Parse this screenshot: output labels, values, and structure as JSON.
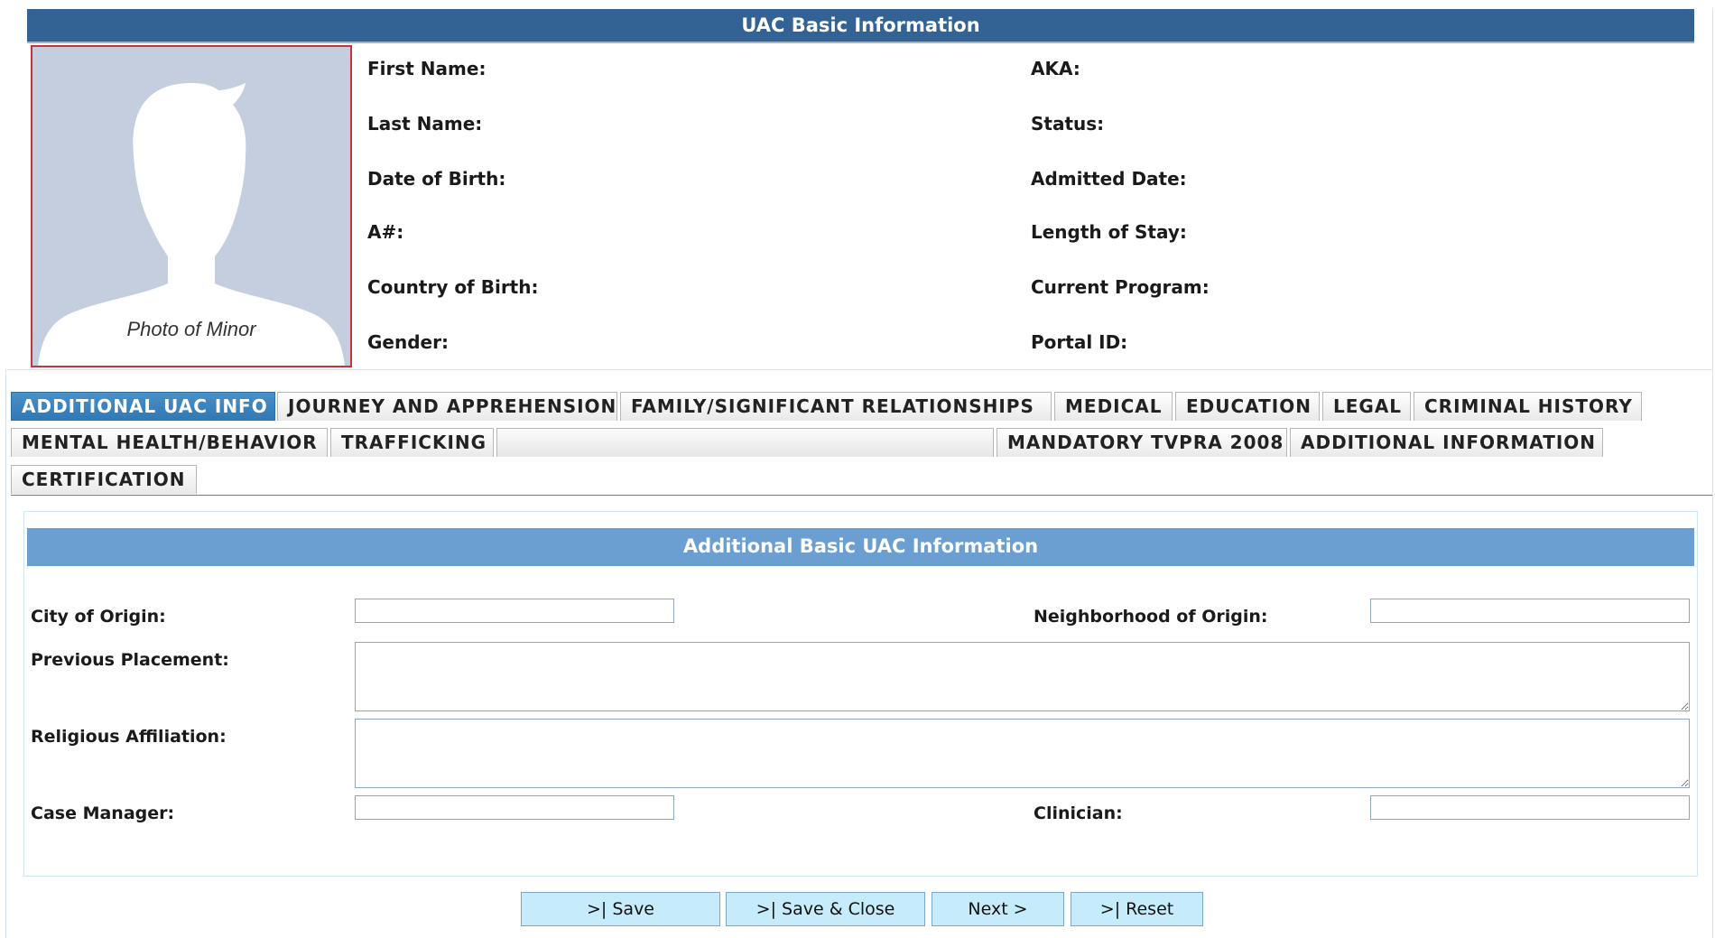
{
  "header": {
    "title": "UAC Basic Information"
  },
  "photo": {
    "caption": "Photo of Minor",
    "border_color": "#c8323a",
    "bg_color": "#c5cedf"
  },
  "basic_info": {
    "left": [
      "First Name:",
      "Last Name:",
      "Date of Birth:",
      "A#:",
      "Country of Birth:",
      "Gender:"
    ],
    "right": [
      "AKA:",
      "Status:",
      "Admitted Date:",
      "Length of Stay:",
      "Current Program:",
      "Portal ID:"
    ]
  },
  "tabs": {
    "row1": [
      "ADDITIONAL UAC INFO",
      "JOURNEY AND APPREHENSION",
      "FAMILY/SIGNIFICANT RELATIONSHIPS",
      "MEDICAL",
      "EDUCATION",
      "LEGAL",
      "CRIMINAL HISTORY"
    ],
    "row2": [
      "MENTAL HEALTH/BEHAVIOR",
      "TRAFFICKING",
      "",
      "MANDATORY TVPRA 2008",
      "ADDITIONAL INFORMATION"
    ],
    "row3": [
      "CERTIFICATION"
    ],
    "active": "ADDITIONAL UAC INFO"
  },
  "section": {
    "title": "Additional Basic UAC Information",
    "fields": {
      "city_of_origin": {
        "label": "City of Origin:",
        "value": ""
      },
      "neighborhood_of_origin": {
        "label": "Neighborhood of Origin:",
        "value": ""
      },
      "previous_placement": {
        "label": "Previous Placement:",
        "value": ""
      },
      "religious_affiliation": {
        "label": "Religious Affiliation:",
        "value": ""
      },
      "case_manager": {
        "label": "Case Manager:",
        "value": ""
      },
      "clinician": {
        "label": "Clinician:",
        "value": ""
      }
    }
  },
  "buttons": {
    "save": ">| Save",
    "save_close": ">| Save & Close",
    "next": "Next >",
    "reset": ">| Reset"
  },
  "colors": {
    "header_bg": "#336394",
    "section_bg": "#6b9fd2",
    "active_tab": "#2f78b4",
    "button_bg": "#c6ecfb"
  }
}
